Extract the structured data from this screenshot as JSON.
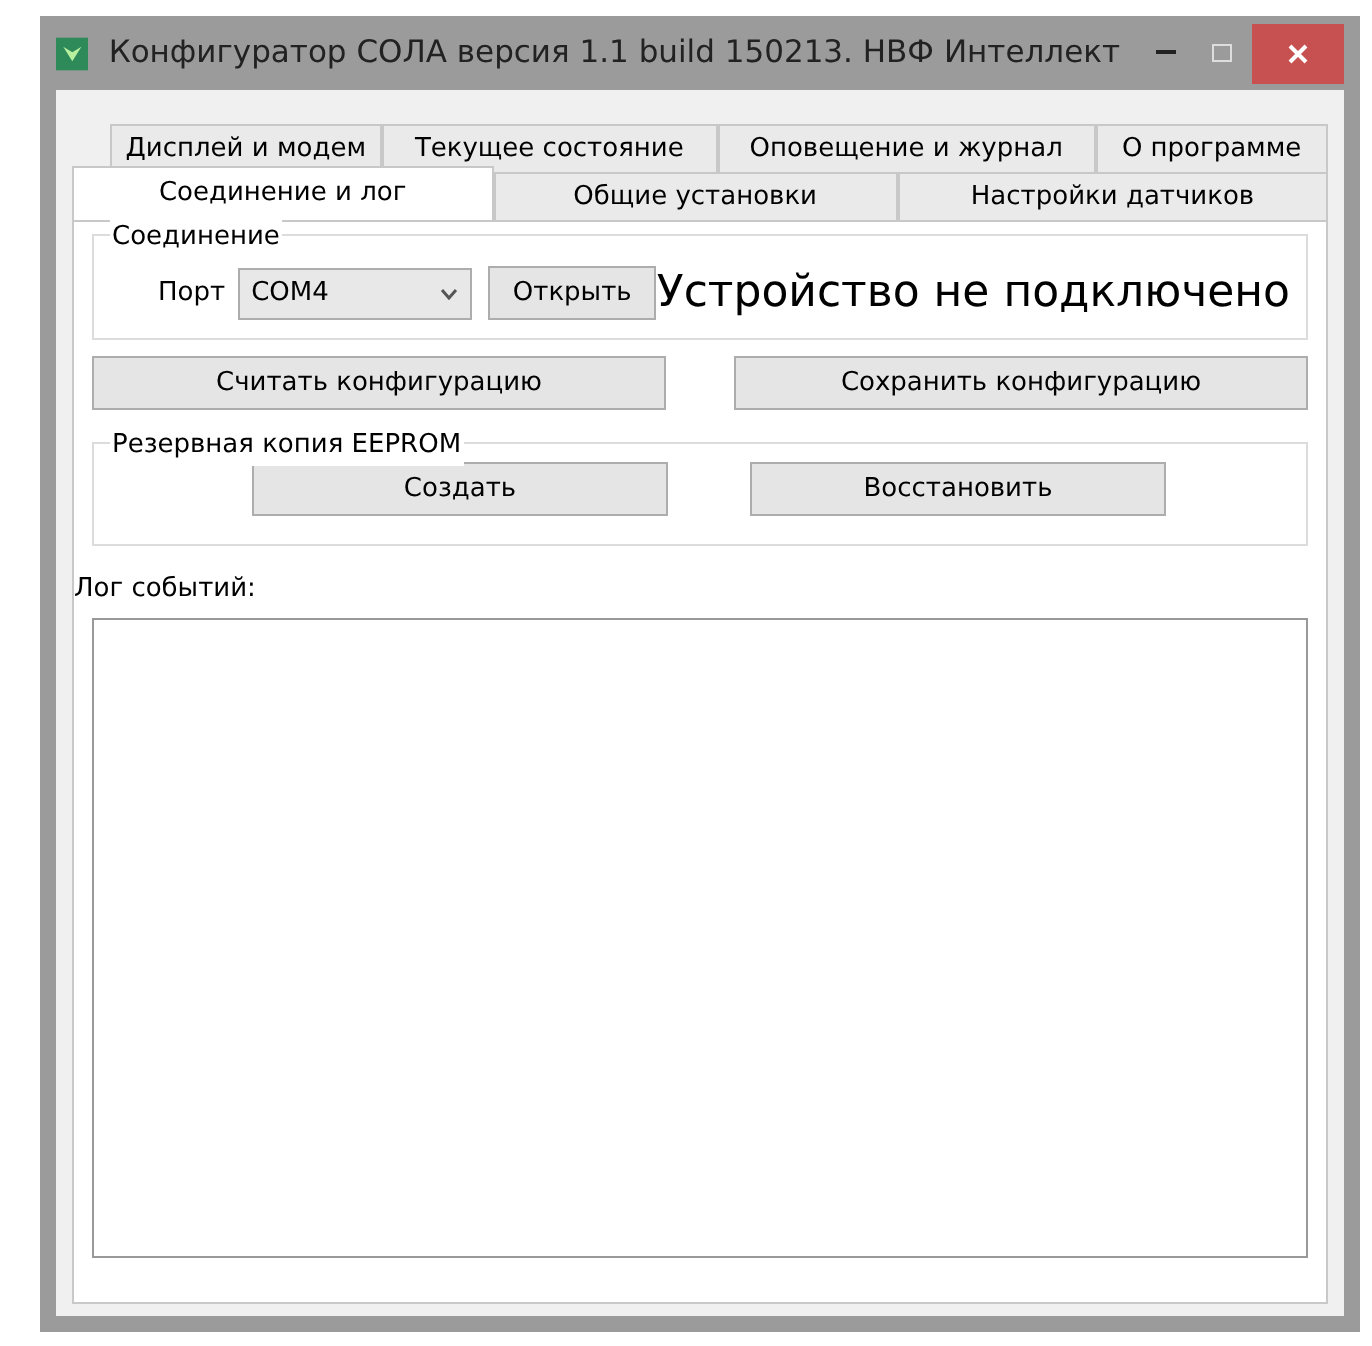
{
  "window": {
    "title": "Конфигуратор СОЛА версия 1.1 build 150213. НВФ Интеллект"
  },
  "tab_rows": [
    [
      {
        "label": "Дисплей и модем",
        "selected": false
      },
      {
        "label": "Текущее состояние",
        "selected": false
      },
      {
        "label": "Оповещение и журнал",
        "selected": false
      },
      {
        "label": "О программе",
        "selected": false
      }
    ],
    [
      {
        "label": "Соединение и лог",
        "selected": true
      },
      {
        "label": "Общие установки",
        "selected": false
      },
      {
        "label": "Настройки датчиков",
        "selected": false
      }
    ]
  ],
  "connection": {
    "title": "Соединение",
    "port_label": "Порт",
    "port_value": "COM4",
    "open_button": "Открыть",
    "status": "Устройство не подключено"
  },
  "config_buttons": [
    "Считать конфигурацию",
    "Сохранить конфигурацию"
  ],
  "backup": {
    "title": "Резервная копия EEPROM",
    "buttons": [
      "Создать",
      "Восстановить"
    ]
  },
  "log": {
    "label": "Лог событий:"
  }
}
